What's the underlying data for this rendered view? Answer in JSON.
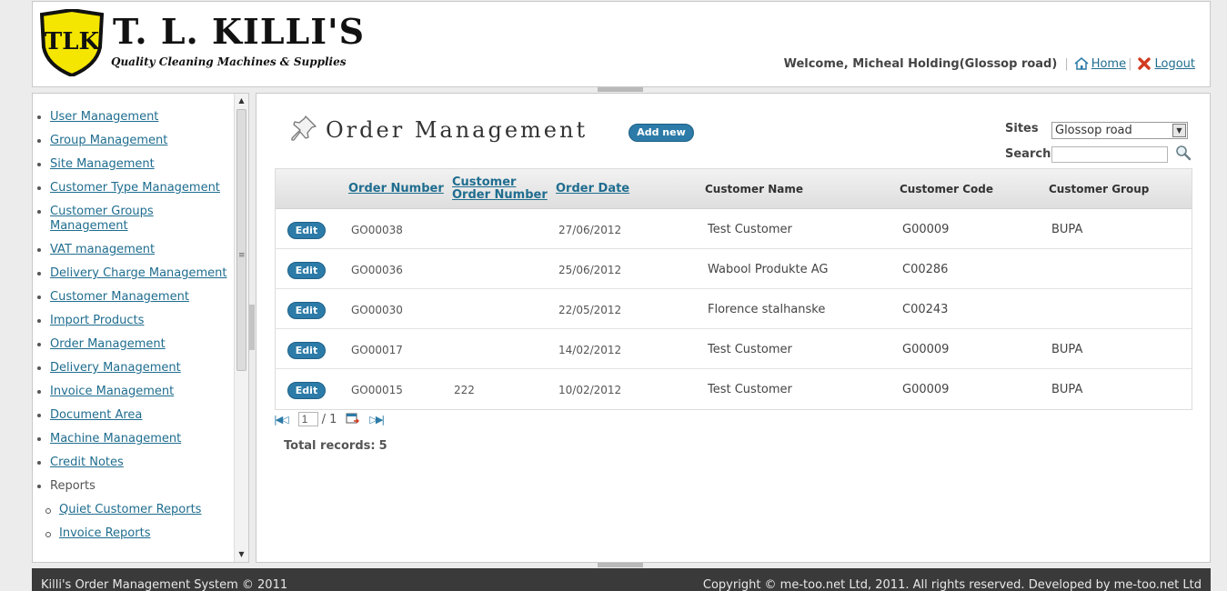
{
  "brand": {
    "badge_text": "TLK",
    "title": "T. L. KILLI'S",
    "tagline": "Quality Cleaning Machines & Supplies",
    "color_badge_yellow": "#f4e600",
    "color_badge_outline": "#111111"
  },
  "header": {
    "welcome": "Welcome, Micheal Holding(Glossop road)",
    "home_label": "Home",
    "logout_label": "Logout"
  },
  "sidebar": {
    "items": [
      {
        "label": "User Management",
        "link": true
      },
      {
        "label": "Group Management",
        "link": true
      },
      {
        "label": "Site Management",
        "link": true
      },
      {
        "label": "Customer Type Management",
        "link": true
      },
      {
        "label": "Customer Groups Management",
        "link": true
      },
      {
        "label": "VAT management",
        "link": true
      },
      {
        "label": "Delivery Charge Management",
        "link": true
      },
      {
        "label": "Customer Management",
        "link": true
      },
      {
        "label": "Import Products",
        "link": true
      },
      {
        "label": "Order Management",
        "link": true
      },
      {
        "label": "Delivery Management",
        "link": true
      },
      {
        "label": "Invoice Management",
        "link": true
      },
      {
        "label": "Document Area",
        "link": true
      },
      {
        "label": "Machine Management",
        "link": true
      },
      {
        "label": "Credit Notes",
        "link": true
      },
      {
        "label": "Reports",
        "link": false
      },
      {
        "label": "Quiet Customer Reports",
        "link": true,
        "sub": true
      },
      {
        "label": "Invoice Reports",
        "link": true,
        "sub": true
      }
    ]
  },
  "main": {
    "title": "Order Management",
    "add_new_label": "Add new",
    "sites_label": "Sites",
    "sites_selected": "Glossop road",
    "search_label": "Search",
    "search_value": "",
    "columns": {
      "order_number": "Order Number",
      "customer_order_number_1": "Customer",
      "customer_order_number_2": "Order Number",
      "order_date": "Order Date",
      "customer_name": "Customer Name",
      "customer_code": "Customer Code",
      "customer_group": "Customer Group"
    },
    "edit_label": "Edit",
    "rows": [
      {
        "order_number": "GO00038",
        "customer_order_number": "",
        "order_date": "27/06/2012",
        "customer_name": "Test Customer",
        "customer_code": "G00009",
        "customer_group": "BUPA"
      },
      {
        "order_number": "GO00036",
        "customer_order_number": "",
        "order_date": "25/06/2012",
        "customer_name": "Wabool Produkte AG",
        "customer_code": "C00286",
        "customer_group": ""
      },
      {
        "order_number": "GO00030",
        "customer_order_number": "",
        "order_date": "22/05/2012",
        "customer_name": "Florence stalhanske",
        "customer_code": "C00243",
        "customer_group": ""
      },
      {
        "order_number": "GO00017",
        "customer_order_number": "",
        "order_date": "14/02/2012",
        "customer_name": "Test Customer",
        "customer_code": "G00009",
        "customer_group": "BUPA"
      },
      {
        "order_number": "GO00015",
        "customer_order_number": "222",
        "order_date": "10/02/2012",
        "customer_name": "Test Customer",
        "customer_code": "G00009",
        "customer_group": "BUPA"
      }
    ],
    "pager": {
      "current_page": "1",
      "total_pages": "/ 1"
    },
    "total_label": "Total records:",
    "total_count": "5"
  },
  "footer": {
    "left": "Killi's Order Management System © 2011",
    "right": "Copyright © me-too.net Ltd, 2011. All rights reserved. Developed by me-too.net Ltd"
  },
  "colors": {
    "accent_blue": "#2c7ba8",
    "link_blue": "#1f6d8f",
    "footer_bg": "#3a3a3a"
  }
}
